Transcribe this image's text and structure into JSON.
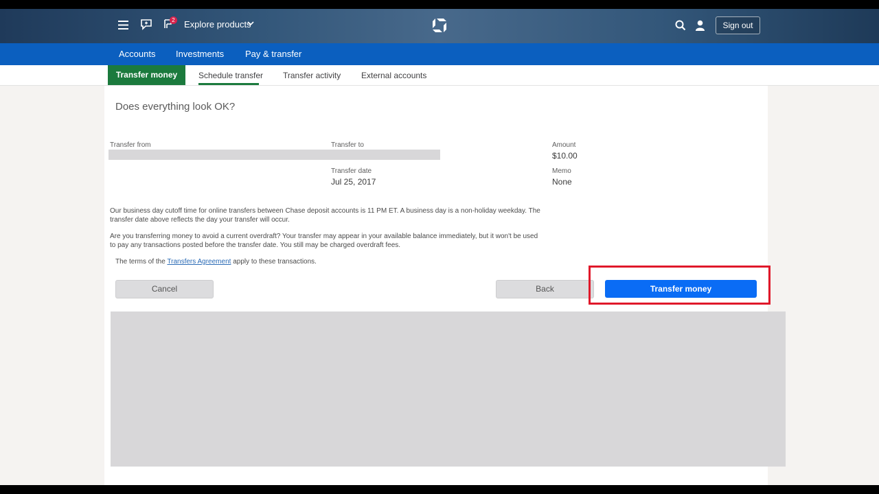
{
  "header": {
    "menu_icon": "hamburger-menu-icon",
    "chat_icon": "chat-icon",
    "notification_icon": "notification-icon",
    "notification_count": "2",
    "explore_label": "Explore products",
    "logo_icon": "chase-logo-icon",
    "search_icon": "search-icon",
    "user_icon": "user-icon",
    "sign_out_label": "Sign out"
  },
  "primary_nav": {
    "items": [
      {
        "label": "Accounts"
      },
      {
        "label": "Investments"
      },
      {
        "label": "Pay & transfer"
      }
    ]
  },
  "sub_nav": {
    "active_tab": "Transfer money",
    "tabs": [
      {
        "label": "Schedule transfer"
      },
      {
        "label": "Transfer activity"
      },
      {
        "label": "External accounts"
      }
    ]
  },
  "review": {
    "question": "Does everything look OK?",
    "transfer_from_label": "Transfer from",
    "transfer_to_label": "Transfer to",
    "amount_label": "Amount",
    "amount_value": "$10.00",
    "transfer_date_label": "Transfer date",
    "transfer_date_value": "Jul 25, 2017",
    "memo_label": "Memo",
    "memo_value": "None",
    "cutoff_note": "Our business day cutoff time for online transfers between Chase deposit accounts is 11 PM ET. A business day is a non-holiday weekday. The transfer date above reflects the day your transfer will occur.",
    "overdraft_note": "Are you transferring money to avoid a current overdraft? Your transfer may appear in your available balance immediately, but it won't be used to pay any transactions posted before the transfer date. You still may be charged overdraft fees.",
    "terms_prefix": "The terms of the ",
    "terms_link": "Transfers Agreement",
    "terms_suffix": " apply to these transactions."
  },
  "actions": {
    "cancel_label": "Cancel",
    "back_label": "Back",
    "submit_label": "Transfer money"
  },
  "colors": {
    "primary_nav": "#0b5fbf",
    "active_tab": "#1b7a3d",
    "submit_button": "#0a6cf5",
    "highlight": "#e0182a"
  }
}
